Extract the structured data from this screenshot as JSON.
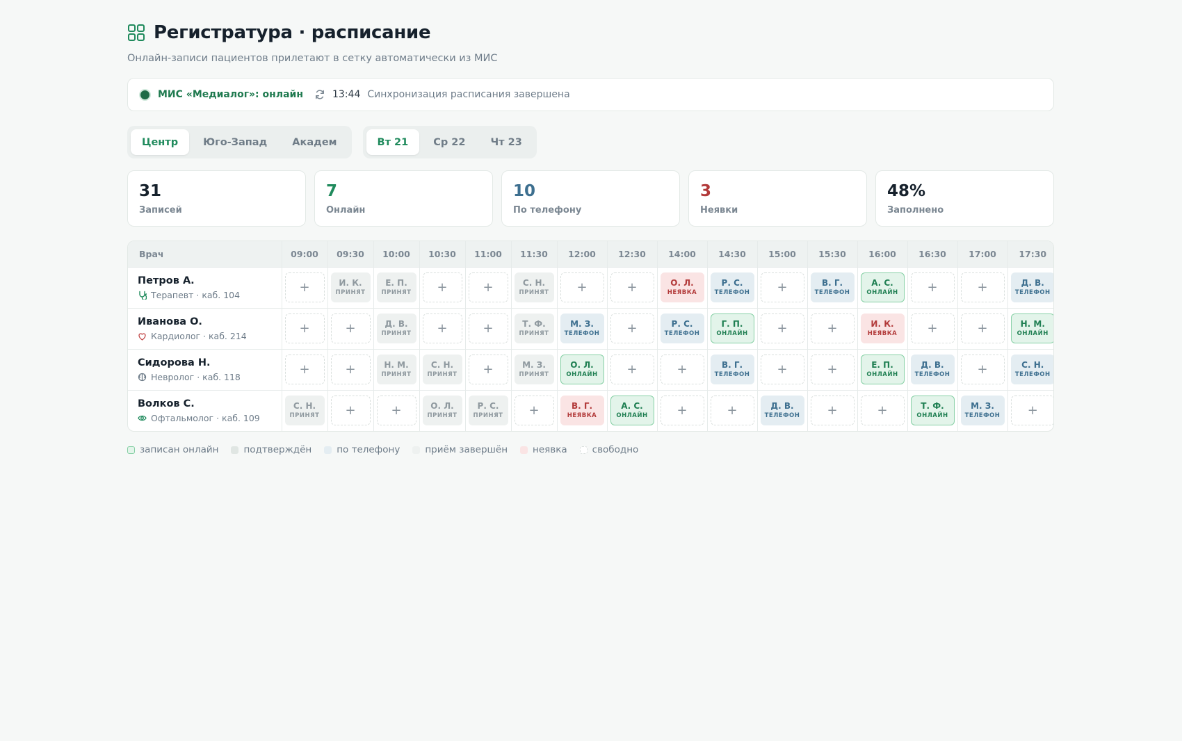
{
  "header": {
    "title": "Регистратура · расписание",
    "subtitle": "Онлайн-записи пациентов прилетают в сетку автоматически из МИС"
  },
  "status": {
    "mis": "МИС «Медиалог»: онлайн",
    "time": "13:44",
    "message": "Синхронизация расписания завершена"
  },
  "branches": [
    {
      "label": "Центр",
      "active": true
    },
    {
      "label": "Юго-Запад",
      "active": false
    },
    {
      "label": "Академ",
      "active": false
    }
  ],
  "days": [
    {
      "label": "Вт 21",
      "active": true
    },
    {
      "label": "Ср 22",
      "active": false
    },
    {
      "label": "Чт 23",
      "active": false
    }
  ],
  "stats": [
    {
      "value": "31",
      "label": "Записей",
      "color": "#16212c"
    },
    {
      "value": "7",
      "label": "Онлайн",
      "color": "#1f8a5c"
    },
    {
      "value": "10",
      "label": "По телефону",
      "color": "#3d6f8f"
    },
    {
      "value": "3",
      "label": "Неявки",
      "color": "#b23a3a"
    },
    {
      "value": "48%",
      "label": "Заполнено",
      "color": "#16212c"
    }
  ],
  "schedule": {
    "doctor_header": "Врач",
    "times": [
      "09:00",
      "09:30",
      "10:00",
      "10:30",
      "11:00",
      "11:30",
      "12:00",
      "12:30",
      "14:00",
      "14:30",
      "15:00",
      "15:30",
      "16:00",
      "16:30",
      "17:00",
      "17:30"
    ],
    "free_symbol": "+",
    "status_labels": {
      "done": "принят",
      "phone": "телефон",
      "online": "онлайн",
      "noshow": "неявка"
    },
    "doctors": [
      {
        "name": "Петров А.",
        "info": "Терапевт · каб. 104",
        "icon": "stethoscope-icon",
        "slots": [
          {
            "s": "free"
          },
          {
            "s": "done",
            "n": "И. К."
          },
          {
            "s": "done",
            "n": "Е. П."
          },
          {
            "s": "free"
          },
          {
            "s": "free"
          },
          {
            "s": "done",
            "n": "С. Н."
          },
          {
            "s": "free"
          },
          {
            "s": "free"
          },
          {
            "s": "noshow",
            "n": "О. Л."
          },
          {
            "s": "phone",
            "n": "Р. С."
          },
          {
            "s": "free"
          },
          {
            "s": "phone",
            "n": "В. Г."
          },
          {
            "s": "online",
            "n": "А. С."
          },
          {
            "s": "free"
          },
          {
            "s": "free"
          },
          {
            "s": "phone",
            "n": "Д. В."
          }
        ]
      },
      {
        "name": "Иванова О.",
        "info": "Кардиолог · каб. 214",
        "icon": "heart-icon",
        "slots": [
          {
            "s": "free"
          },
          {
            "s": "free"
          },
          {
            "s": "done",
            "n": "Д. В."
          },
          {
            "s": "free"
          },
          {
            "s": "free"
          },
          {
            "s": "done",
            "n": "Т. Ф."
          },
          {
            "s": "phone",
            "n": "М. З."
          },
          {
            "s": "free"
          },
          {
            "s": "phone",
            "n": "Р. С."
          },
          {
            "s": "online",
            "n": "Г. П."
          },
          {
            "s": "free"
          },
          {
            "s": "free"
          },
          {
            "s": "noshow",
            "n": "И. К."
          },
          {
            "s": "free"
          },
          {
            "s": "free"
          },
          {
            "s": "online",
            "n": "Н. М."
          }
        ]
      },
      {
        "name": "Сидорова Н.",
        "info": "Невролог · каб. 118",
        "icon": "brain-icon",
        "slots": [
          {
            "s": "free"
          },
          {
            "s": "free"
          },
          {
            "s": "done",
            "n": "Н. М."
          },
          {
            "s": "done",
            "n": "С. Н."
          },
          {
            "s": "free"
          },
          {
            "s": "done",
            "n": "М. З."
          },
          {
            "s": "online",
            "n": "О. Л."
          },
          {
            "s": "free"
          },
          {
            "s": "free"
          },
          {
            "s": "phone",
            "n": "В. Г."
          },
          {
            "s": "free"
          },
          {
            "s": "free"
          },
          {
            "s": "online",
            "n": "Е. П."
          },
          {
            "s": "phone",
            "n": "Д. В."
          },
          {
            "s": "free"
          },
          {
            "s": "phone",
            "n": "С. Н."
          }
        ]
      },
      {
        "name": "Волков С.",
        "info": "Офтальмолог · каб. 109",
        "icon": "eye-icon",
        "slots": [
          {
            "s": "done",
            "n": "С. Н."
          },
          {
            "s": "free"
          },
          {
            "s": "free"
          },
          {
            "s": "done",
            "n": "О. Л."
          },
          {
            "s": "done",
            "n": "Р. С."
          },
          {
            "s": "free"
          },
          {
            "s": "noshow",
            "n": "В. Г."
          },
          {
            "s": "online",
            "n": "А. С."
          },
          {
            "s": "free"
          },
          {
            "s": "free"
          },
          {
            "s": "phone",
            "n": "Д. В."
          },
          {
            "s": "free"
          },
          {
            "s": "free"
          },
          {
            "s": "online",
            "n": "Т. Ф."
          },
          {
            "s": "phone",
            "n": "М. З."
          },
          {
            "s": "free"
          }
        ]
      }
    ]
  },
  "legend": [
    {
      "label": "записан онлайн",
      "kind": "online"
    },
    {
      "label": "подтверждён",
      "kind": "confirmed"
    },
    {
      "label": "по телефону",
      "kind": "phone"
    },
    {
      "label": "приём завершён",
      "kind": "done"
    },
    {
      "label": "неявка",
      "kind": "noshow"
    },
    {
      "label": "свободно",
      "kind": "free"
    }
  ]
}
